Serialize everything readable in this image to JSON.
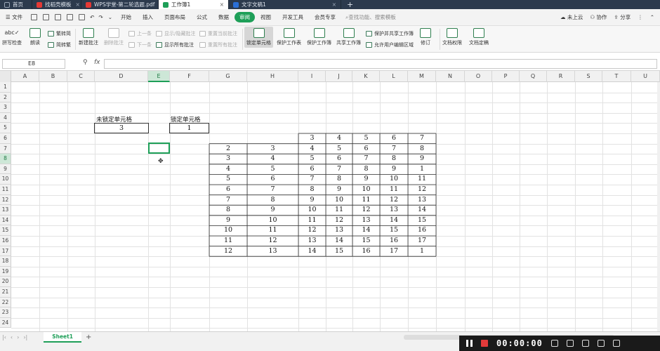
{
  "tabs": [
    {
      "label": "首页",
      "icon": "home-icon",
      "color": "#2c3a4d"
    },
    {
      "label": "找稻壳模板",
      "icon": "docer-icon",
      "color": "#e53935"
    },
    {
      "label": "WPS学堂-第二轮选题.pdf",
      "icon": "pdf-icon",
      "color": "#e53935"
    },
    {
      "label": "工作簿1",
      "icon": "spreadsheet-icon",
      "color": "#1e9f58"
    },
    {
      "label": "文字文稿1",
      "icon": "writer-icon",
      "color": "#2b6fd6"
    }
  ],
  "tab_close": "×",
  "tab_add": "+",
  "menu": {
    "file": "文件",
    "items": [
      "开始",
      "插入",
      "页面布局",
      "公式",
      "数据",
      "审阅",
      "视图",
      "开发工具",
      "会员专享"
    ],
    "active": "审阅",
    "search": "查找功能、搜索模板",
    "right": {
      "cloud": "未上云",
      "collab": "协作",
      "share": "分享"
    }
  },
  "ribbon": {
    "spellcheck": "拼写检查",
    "read": "朗读",
    "trad": "繁转简",
    "simp": "简转繁",
    "new_comment": "新建批注",
    "delete_comment": "删除批注",
    "prev": "上一条",
    "next": "下一条",
    "show_hide_comment": "显示/隐藏批注",
    "show_all_comments": "显示所有批注",
    "reset_current": "重置当前批注",
    "reset_all": "重置所有批注",
    "lock_cell": "锁定单元格",
    "protect_sheet": "保护工作表",
    "protect_book": "保护工作簿",
    "share_book": "共享工作簿",
    "protect_share": "保护并共享工作簿",
    "allow_edit": "允许用户编辑区域",
    "track": "修订",
    "doc_perm": "文档权限",
    "doc_final": "文档定稿"
  },
  "formula_bar": {
    "name_box": "E8",
    "fx": "fx",
    "value": ""
  },
  "columns": [
    "A",
    "B",
    "C",
    "D",
    "E",
    "F",
    "G",
    "H",
    "I",
    "J",
    "K",
    "L",
    "M",
    "N",
    "O",
    "P",
    "Q",
    "R",
    "S",
    "T",
    "U"
  ],
  "rows": [
    "1",
    "2",
    "3",
    "4",
    "5",
    "6",
    "7",
    "8",
    "9",
    "10",
    "11",
    "12",
    "13",
    "14",
    "15",
    "16",
    "17",
    "18",
    "19",
    "20",
    "21",
    "22",
    "23",
    "24"
  ],
  "selected_cell": {
    "col": "E",
    "row": "8"
  },
  "labels": {
    "unlocked": "未锁定单元格",
    "locked": "锁定单元格"
  },
  "input_values": {
    "unlocked": "3",
    "locked": "1"
  },
  "table": {
    "header_row": [
      "3",
      "4",
      "5",
      "6",
      "7"
    ],
    "rows": [
      [
        "2",
        "3",
        "4",
        "5",
        "6",
        "7",
        "8"
      ],
      [
        "3",
        "4",
        "5",
        "6",
        "7",
        "8",
        "9"
      ],
      [
        "4",
        "5",
        "6",
        "7",
        "8",
        "9",
        "1"
      ],
      [
        "5",
        "6",
        "7",
        "8",
        "9",
        "10",
        "11"
      ],
      [
        "6",
        "7",
        "8",
        "9",
        "10",
        "11",
        "12"
      ],
      [
        "7",
        "8",
        "9",
        "10",
        "11",
        "12",
        "13"
      ],
      [
        "8",
        "9",
        "10",
        "11",
        "12",
        "13",
        "14"
      ],
      [
        "9",
        "10",
        "11",
        "12",
        "13",
        "14",
        "15"
      ],
      [
        "10",
        "11",
        "12",
        "13",
        "14",
        "15",
        "16"
      ],
      [
        "11",
        "12",
        "13",
        "14",
        "15",
        "16",
        "17"
      ],
      [
        "12",
        "13",
        "14",
        "15",
        "16",
        "17",
        "1"
      ]
    ]
  },
  "sheet_tab": "Sheet1",
  "recorder": {
    "time": "00:00:00"
  }
}
